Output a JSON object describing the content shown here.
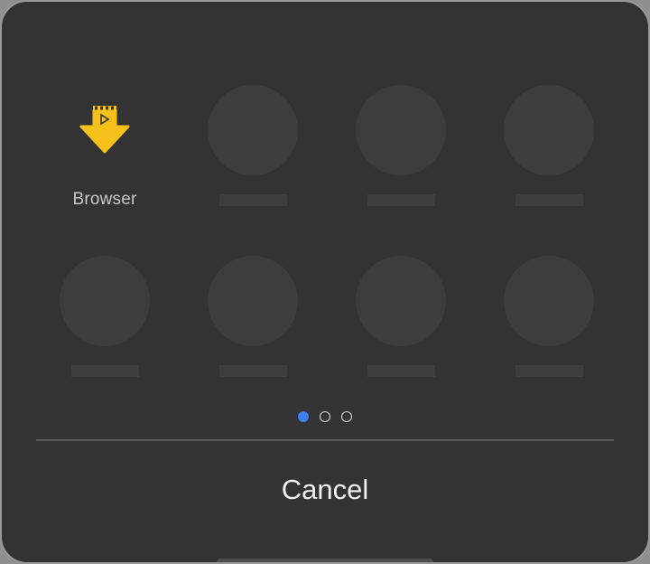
{
  "dialog": {
    "apps": [
      {
        "label": "Browser",
        "icon": "download-arrow-icon",
        "accent": "#f6c11b"
      },
      {
        "label": "",
        "icon": "placeholder"
      },
      {
        "label": "",
        "icon": "placeholder"
      },
      {
        "label": "",
        "icon": "placeholder"
      },
      {
        "label": "",
        "icon": "placeholder"
      },
      {
        "label": "",
        "icon": "placeholder"
      },
      {
        "label": "",
        "icon": "placeholder"
      },
      {
        "label": "",
        "icon": "placeholder"
      }
    ],
    "pagination": {
      "current": 1,
      "total": 3,
      "active_color": "#3d7ff0"
    },
    "cancel_label": "Cancel"
  }
}
